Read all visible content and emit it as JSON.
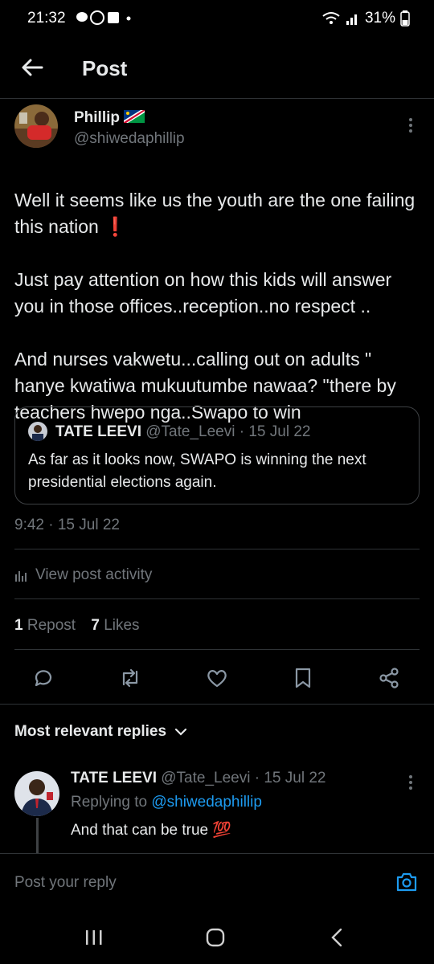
{
  "status": {
    "time": "21:32",
    "battery": "31%"
  },
  "header": {
    "title": "Post"
  },
  "post": {
    "author_name": "Phillip",
    "author_handle": "@shiwedaphillip",
    "text_lines": [
      "Well it seems like us the youth are the one failing this nation ❗",
      "Just pay attention on how this kids will answer you in those offices..reception..no respect ..",
      "And nurses vakwetu...calling out on adults \" hanye kwatiwa mukuutumbe nawaa? \"there by teachers hwepo nga..Swapo to win"
    ],
    "quote": {
      "author_name": "TATE LEEVI",
      "author_handle": "@Tate_Leevi",
      "date": "· 15 Jul 22",
      "text": "As far as it looks now, SWAPO is winning the next presidential elections again."
    },
    "timestamp": "9:42 · 15 Jul 22",
    "activity_label": "View post activity",
    "reposts_count": "1",
    "reposts_label": "Repost",
    "likes_count": "7",
    "likes_label": "Likes"
  },
  "replies": {
    "sort_label": "Most relevant replies",
    "items": [
      {
        "author_name": "TATE LEEVI",
        "author_handle": "@Tate_Leevi",
        "date": "· 15 Jul 22",
        "replying_prefix": "Replying to",
        "replying_to": "@shiwedaphillip",
        "text": "And that can be true 💯"
      }
    ]
  },
  "composer": {
    "placeholder": "Post your reply"
  },
  "colors": {
    "accent": "#1d9bf0",
    "muted": "#71767b",
    "divider": "#2f3336",
    "background": "#000000"
  },
  "icons": [
    "back-arrow-icon",
    "more-icon",
    "reply-icon",
    "repost-icon",
    "like-icon",
    "bookmark-icon",
    "share-icon",
    "analytics-icon",
    "chevron-down-icon",
    "camera-icon"
  ]
}
